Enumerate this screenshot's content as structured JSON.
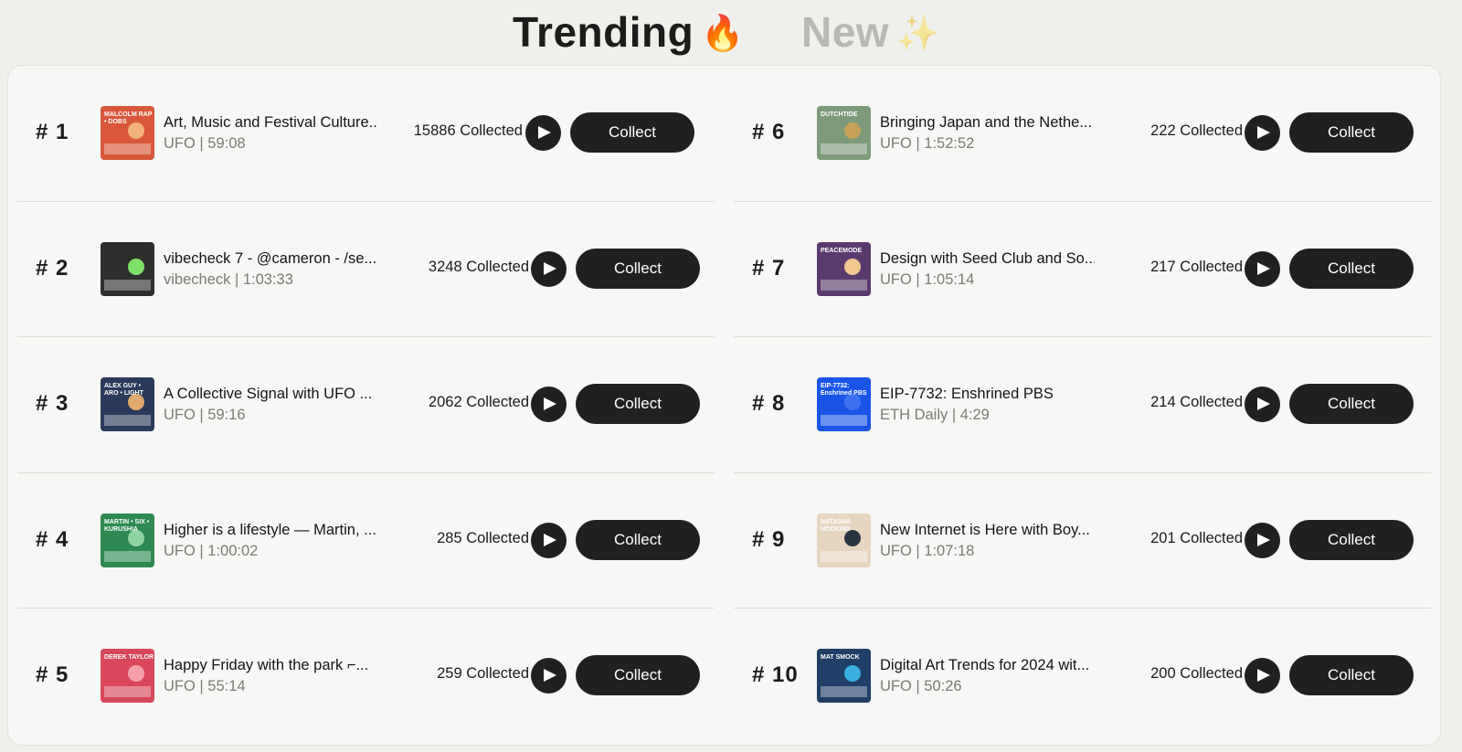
{
  "tabs": {
    "trending_label": "Trending",
    "trending_emoji": "🔥",
    "new_label": "New",
    "new_emoji": "✨"
  },
  "collect_label": "Collect",
  "rows_left": [
    {
      "rank": "# 1",
      "title": "Art, Music and Festival Culture...",
      "subtitle": "UFO | 59:08",
      "count": "15886 Collected",
      "thumb_bg": "#d9573a",
      "thumb_accent": "#f2b07a",
      "thumb_text": "MALCOLM RAP • DOBS"
    },
    {
      "rank": "# 2",
      "title": "vibecheck 7 - @cameron - /se...",
      "subtitle": "vibecheck | 1:03:33",
      "count": "3248 Collected",
      "thumb_bg": "#2d2f2c",
      "thumb_accent": "#7fe06a",
      "thumb_text": ""
    },
    {
      "rank": "# 3",
      "title": "A Collective Signal with UFO ...",
      "subtitle": "UFO | 59:16",
      "count": "2062 Collected",
      "thumb_bg": "#2b3a5c",
      "thumb_accent": "#e0a96d",
      "thumb_text": "ALEX GUY • ARO • LIGHT"
    },
    {
      "rank": "# 4",
      "title": "Higher is a lifestyle — Martin, ...",
      "subtitle": "UFO | 1:00:02",
      "count": "285 Collected",
      "thumb_bg": "#2f8a52",
      "thumb_accent": "#8fd4a0",
      "thumb_text": "MARTIN • SIX • KURUSHIA"
    },
    {
      "rank": "# 5",
      "title": "Happy Friday with the park ⌐...",
      "subtitle": "UFO | 55:14",
      "count": "259 Collected",
      "thumb_bg": "#d8485a",
      "thumb_accent": "#f5a0a8",
      "thumb_text": "DEREK TAYLOR"
    }
  ],
  "rows_right": [
    {
      "rank": "# 6",
      "title": "Bringing Japan and the Nethe...",
      "subtitle": "UFO | 1:52:52",
      "count": "222 Collected",
      "thumb_bg": "#7d9a7a",
      "thumb_accent": "#c7a05a",
      "thumb_text": "DUTCHTIDE"
    },
    {
      "rank": "# 7",
      "title": "Design with Seed Club and So...",
      "subtitle": "UFO | 1:05:14",
      "count": "217 Collected",
      "thumb_bg": "#5a3a6e",
      "thumb_accent": "#f0c890",
      "thumb_text": "PEACEMODE"
    },
    {
      "rank": "# 8",
      "title": "EIP-7732: Enshrined PBS",
      "subtitle": "ETH Daily | 4:29",
      "count": "214 Collected",
      "thumb_bg": "#1b55e8",
      "thumb_accent": "#3f72f0",
      "thumb_text": "EIP-7732: Enshrined PBS"
    },
    {
      "rank": "# 9",
      "title": "New Internet is Here with Boy...",
      "subtitle": "UFO | 1:07:18",
      "count": "201 Collected",
      "thumb_bg": "#e6d6c0",
      "thumb_accent": "#2a3440",
      "thumb_text": "NATASHA HOOKINS"
    },
    {
      "rank": "# 10",
      "title": "Digital Art Trends for 2024 wit...",
      "subtitle": "UFO | 50:26",
      "count": "200 Collected",
      "thumb_bg": "#1f3f66",
      "thumb_accent": "#3bb0e0",
      "thumb_text": "MAT SMOCK"
    }
  ]
}
